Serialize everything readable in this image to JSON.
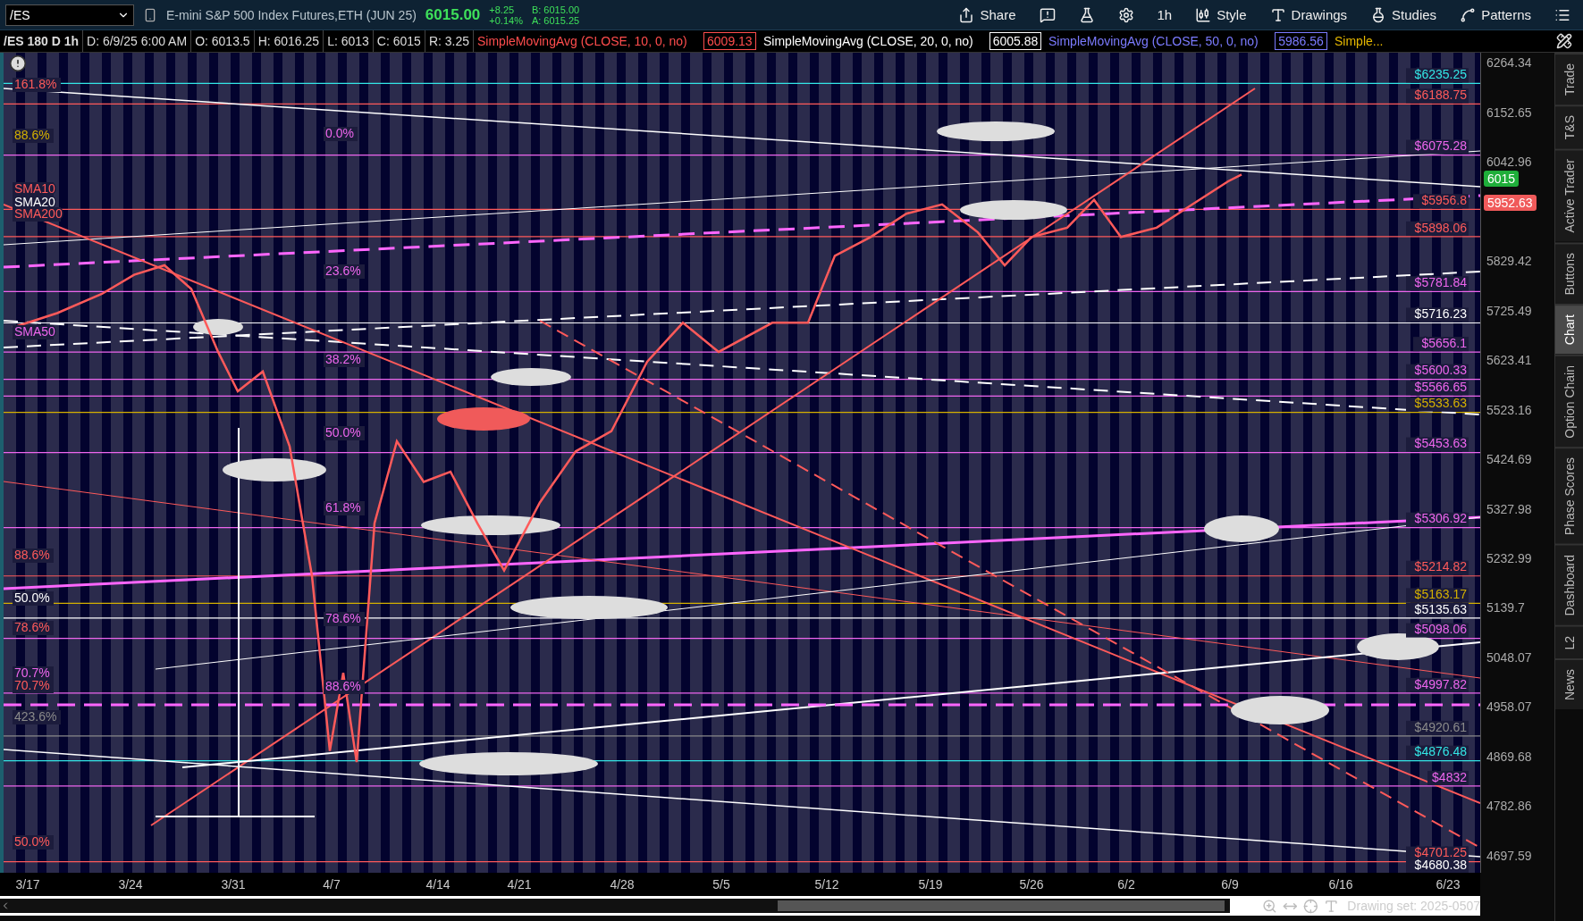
{
  "symbol_field": {
    "value": "/ES"
  },
  "instrument": "E-mini S&P 500 Index Futures,ETH (JUN 25)",
  "quote": {
    "last": "6015.00",
    "change": "+8.25",
    "change_pct": "+0.14%",
    "bid": "B: 6015.00",
    "ask": "A: 6015.25"
  },
  "toolbar": [
    {
      "kind": "share",
      "label": "Share"
    },
    {
      "kind": "alert"
    },
    {
      "kind": "flask"
    },
    {
      "kind": "gear"
    },
    {
      "kind": "timeframe",
      "label": "1h"
    },
    {
      "kind": "style",
      "label": "Style"
    },
    {
      "kind": "drawings",
      "label": "Drawings"
    },
    {
      "kind": "studies",
      "label": "Studies"
    },
    {
      "kind": "patterns",
      "label": "Patterns"
    },
    {
      "kind": "menu"
    }
  ],
  "header": {
    "title": "/ES 180 D 1h",
    "fields": [
      "D: 6/9/25 6:00 AM",
      "O: 6013.5",
      "H: 6016.25",
      "L: 6013",
      "C: 6015",
      "R: 3.25"
    ],
    "studies": [
      {
        "name": "SimpleMovingAvg (CLOSE, 10, 0, no)",
        "value": "6009.13",
        "color": "#ff4d4d"
      },
      {
        "name": "SimpleMovingAvg (CLOSE, 20, 0, no)",
        "value": "6005.88",
        "color": "#ffffff"
      },
      {
        "name": "SimpleMovingAvg (CLOSE, 50, 0, no)",
        "value": "5986.56",
        "color": "#7b7bff"
      },
      {
        "name": "Simple...",
        "color": "#e6b800"
      }
    ]
  },
  "chart": {
    "price_axis": [
      "6264.34",
      "6152.65",
      "6042.96",
      "5829.42",
      "5725.49",
      "5623.41",
      "5523.16",
      "5424.69",
      "5327.98",
      "5232.99",
      "5139.7",
      "5048.07",
      "4958.07",
      "4869.68",
      "4782.86",
      "4697.59"
    ],
    "date_axis": [
      "3/17",
      "3/24",
      "3/31",
      "4/7",
      "4/14",
      "4/21",
      "4/28",
      "5/5",
      "5/12",
      "5/19",
      "5/26",
      "6/2",
      "6/9",
      "6/16",
      "6/23"
    ],
    "badges": [
      {
        "label": "6015",
        "color": "#1fae3a"
      },
      {
        "label": "5952.63",
        "color": "#f05a5a"
      }
    ],
    "left_labels": [
      {
        "label": "161.8%",
        "color": "#ff5a5a"
      },
      {
        "label": "88.6%",
        "color": "#d4b000"
      },
      {
        "label": "0.0%",
        "color": "#ee66ee"
      },
      {
        "label": "SMA10",
        "color": "#ff5a5a"
      },
      {
        "label": "SMA20",
        "color": "#ffffff"
      },
      {
        "label": "SMA200",
        "color": "#ff5a5a"
      },
      {
        "label": "23.6%",
        "color": "#ee66ee"
      },
      {
        "label": "SMA50",
        "color": "#ee66ee"
      },
      {
        "label": "38.2%",
        "color": "#ee66ee"
      },
      {
        "label": "50.0%",
        "color": "#ee66ee"
      },
      {
        "label": "61.8%",
        "color": "#ee66ee"
      },
      {
        "label": "88.6%",
        "color": "#ff5a5a"
      },
      {
        "label": "50.0%",
        "color": "#ffffff"
      },
      {
        "label": "78.6%",
        "color": "#ee66ee"
      },
      {
        "label": "78.6%",
        "color": "#ff5a5a"
      },
      {
        "label": "70.7%",
        "color": "#ee66ee"
      },
      {
        "label": "70.7%",
        "color": "#ff5a5a"
      },
      {
        "label": "88.6%",
        "color": "#ee66ee"
      },
      {
        "label": "423.6%",
        "color": "#8a8a8a"
      },
      {
        "label": "50.0%",
        "color": "#ff5a5a"
      }
    ],
    "levels": [
      {
        "label": "$6235.25",
        "color": "#33e6e6"
      },
      {
        "label": "$6188.75",
        "color": "#ff5a5a"
      },
      {
        "label": "$6075.28",
        "color": "#ee66ee"
      },
      {
        "label": "$5956.8",
        "color": "#ff5a5a"
      },
      {
        "label": "$5898.06",
        "color": "#ff5a5a"
      },
      {
        "label": "$5781.84",
        "color": "#ee66ee"
      },
      {
        "label": "$5716.23",
        "color": "#ffffff"
      },
      {
        "label": "$5656.1",
        "color": "#ee66ee"
      },
      {
        "label": "$5600.33",
        "color": "#ee66ee"
      },
      {
        "label": "$5566.65",
        "color": "#ee66ee"
      },
      {
        "label": "$5533.63",
        "color": "#d4b000"
      },
      {
        "label": "$5453.63",
        "color": "#ee66ee"
      },
      {
        "label": "$5306.92",
        "color": "#ee66ee"
      },
      {
        "label": "$5214.82",
        "color": "#ff5a5a"
      },
      {
        "label": "$5163.17",
        "color": "#d4b000"
      },
      {
        "label": "$5135.63",
        "color": "#ffffff"
      },
      {
        "label": "$5098.06",
        "color": "#ee66ee"
      },
      {
        "label": "$4997.82",
        "color": "#ee66ee"
      },
      {
        "label": "$4920.61",
        "color": "#8a8a8a"
      },
      {
        "label": "$4876.48",
        "color": "#33e6e6"
      },
      {
        "label": "$4832",
        "color": "#ee66ee"
      },
      {
        "label": "$4701.25",
        "color": "#ff5a5a"
      },
      {
        "label": "$4680.38",
        "color": "#ffffff"
      }
    ]
  },
  "sidebar": [
    {
      "label": "Trade",
      "selected": false
    },
    {
      "label": "T&S",
      "selected": false
    },
    {
      "label": "Active Trader",
      "selected": false
    },
    {
      "label": "Buttons",
      "selected": false
    },
    {
      "label": "Chart",
      "selected": true
    },
    {
      "label": "Option Chain",
      "selected": false
    },
    {
      "label": "Phase Scores",
      "selected": false
    },
    {
      "label": "Dashboard",
      "selected": false
    },
    {
      "label": "L2",
      "selected": false
    },
    {
      "label": "News",
      "selected": false
    }
  ],
  "status": {
    "drawing_set": "Drawing set: 2025-0507"
  }
}
